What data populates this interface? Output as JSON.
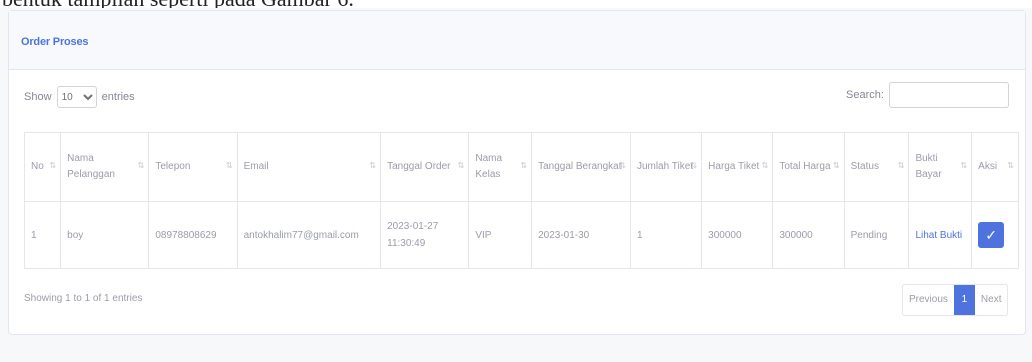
{
  "top_text": "bentuk tampilan seperti pada Gambar 6.",
  "card": {
    "title": "Order Proses"
  },
  "controls": {
    "show_label": "Show",
    "page_size": "10",
    "entries_label": "entries",
    "search_label": "Search:",
    "search_value": ""
  },
  "table": {
    "columns": [
      "No",
      "Nama Pelanggan",
      "Telepon",
      "Email",
      "Tanggal Order",
      "Nama Kelas",
      "Tanggal Berangkat",
      "Jumlah Tiket",
      "Harga Tiket",
      "Total Harga",
      "Status",
      "Bukti Bayar",
      "Aksi"
    ],
    "rows": [
      {
        "no": "1",
        "nama": "boy",
        "telepon": "08978808629",
        "email": "antokhalim77@gmail.com",
        "tanggal_order": "2023-01-27 11:30:49",
        "kelas": "VIP",
        "tanggal_berangkat": "2023-01-30",
        "jumlah": "1",
        "harga": "300000",
        "total": "300000",
        "status": "Pending",
        "bukti": "Lihat Bukti",
        "aksi_icon": "check-icon"
      }
    ]
  },
  "footer": {
    "info": "Showing 1 to 1 of 1 entries",
    "previous": "Previous",
    "page": "1",
    "next": "Next"
  },
  "colors": {
    "accent": "#4e73df",
    "border": "#e3e6f0",
    "text": "#858796"
  }
}
